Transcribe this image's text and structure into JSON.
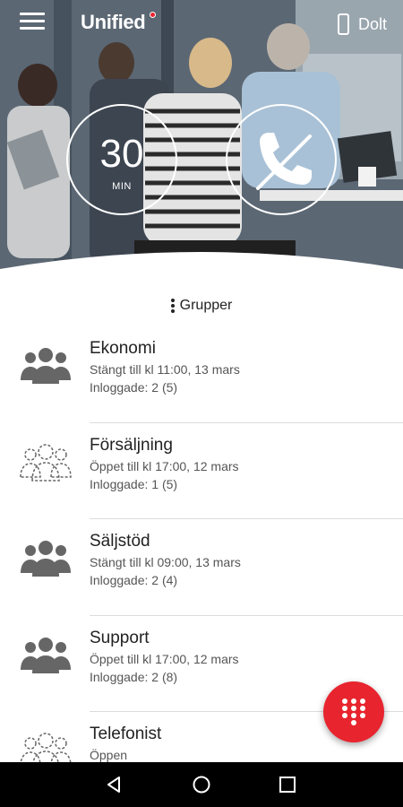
{
  "app": {
    "logo_text": "Unified",
    "status_label": "Dolt",
    "accent_color": "#e8242e"
  },
  "hero": {
    "timer_value": "30",
    "timer_unit": "MIN",
    "call_icon": "phone-off-icon"
  },
  "groups": {
    "header_label": "Grupper",
    "items": [
      {
        "name": "Ekonomi",
        "status": "Stängt till kl 11:00, 13 mars",
        "count": "Inloggade: 2 (5)",
        "icon": "group-filled-icon"
      },
      {
        "name": "Försäljning",
        "status": "Öppet till kl 17:00, 12 mars",
        "count": "Inloggade: 1 (5)",
        "icon": "group-outline-icon"
      },
      {
        "name": "Säljstöd",
        "status": "Stängt till kl 09:00, 13 mars",
        "count": "Inloggade: 2 (4)",
        "icon": "group-filled-icon"
      },
      {
        "name": "Support",
        "status": "Öppet till kl 17:00, 12 mars",
        "count": "Inloggade: 2 (8)",
        "icon": "group-filled-icon"
      },
      {
        "name": "Telefonist",
        "status": "Öppen",
        "count": "",
        "icon": "group-outline-icon"
      }
    ]
  },
  "fab": {
    "icon": "dialpad-icon"
  },
  "navbar": {
    "back_icon": "back-icon",
    "home_icon": "home-icon",
    "recent_icon": "recent-apps-icon"
  }
}
